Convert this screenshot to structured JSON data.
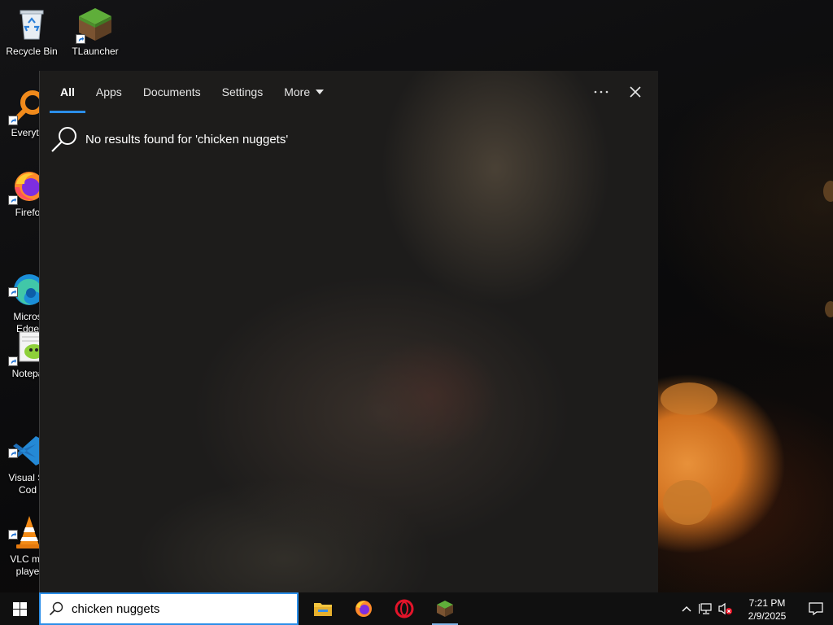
{
  "desktop": {
    "icons": [
      {
        "label": "Recycle Bin",
        "icon": "recycle-bin-icon"
      },
      {
        "label": "TLauncher",
        "icon": "minecraft-grass-block-icon"
      },
      {
        "label": "Everyth",
        "icon": "everything-search-icon"
      },
      {
        "label": "Firefo",
        "icon": "firefox-icon"
      },
      {
        "label": "Micros\nEdge",
        "icon": "edge-icon"
      },
      {
        "label": "Notepa",
        "icon": "notepad-plus-plus-icon"
      },
      {
        "label": "Visual St\nCod",
        "icon": "vscode-icon"
      },
      {
        "label": "VLC me\nplaye",
        "icon": "vlc-icon"
      }
    ]
  },
  "search_panel": {
    "tabs": [
      {
        "label": "All",
        "active": true
      },
      {
        "label": "Apps"
      },
      {
        "label": "Documents"
      },
      {
        "label": "Settings"
      },
      {
        "label": "More"
      }
    ],
    "more_options_icon": "ellipsis-icon",
    "close_icon": "close-icon",
    "no_results_text": "No results found for 'chicken nuggets'"
  },
  "taskbar": {
    "start_icon": "windows-logo-icon",
    "search": {
      "value": "chicken nuggets",
      "icon": "search-icon"
    },
    "apps": [
      "file-explorer-icon",
      "firefox-icon",
      "opera-icon",
      "minecraft-grass-block-icon"
    ],
    "tray_icons": [
      "chevron-up-icon",
      "network-icon",
      "volume-muted-icon"
    ],
    "clock": {
      "time": "7:21 PM",
      "date": "2/9/2025"
    },
    "notification_icon": "action-center-icon"
  },
  "colors": {
    "accent": "#2b8ee8",
    "taskbar": "#101010",
    "panel": "#1d1c1b"
  }
}
